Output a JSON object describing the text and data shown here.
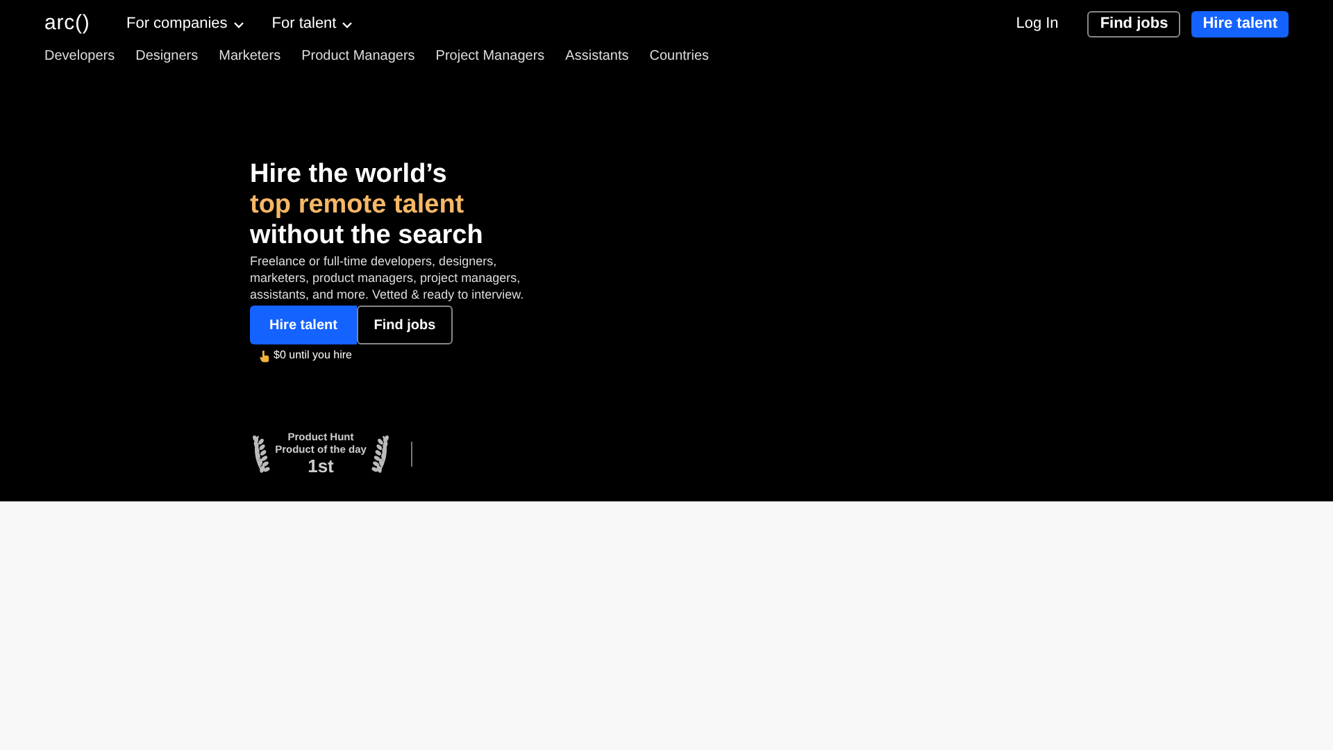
{
  "header": {
    "logo": "arc()",
    "menus": [
      {
        "label": "For companies"
      },
      {
        "label": "For talent"
      }
    ],
    "login": "Log In",
    "find_jobs": "Find jobs",
    "hire_talent": "Hire talent"
  },
  "categories": [
    "Developers",
    "Designers",
    "Marketers",
    "Product Managers",
    "Project Managers",
    "Assistants",
    "Countries"
  ],
  "hero": {
    "headline_lines": [
      {
        "text": "Hire the world’s",
        "highlight": false
      },
      {
        "text": "top remote talent",
        "highlight": true
      },
      {
        "text": "without the search",
        "highlight": false
      }
    ],
    "description": "Freelance or full-time developers, designers, marketers, product managers, project managers, assistants, and more. Vetted & ready to interview.",
    "primary_button": "Hire talent",
    "secondary_button": "Find jobs",
    "note": "$0 until you hire",
    "award": {
      "line_1": "Product Hunt",
      "line_2": "Product of the day",
      "rank": "1st"
    }
  }
}
